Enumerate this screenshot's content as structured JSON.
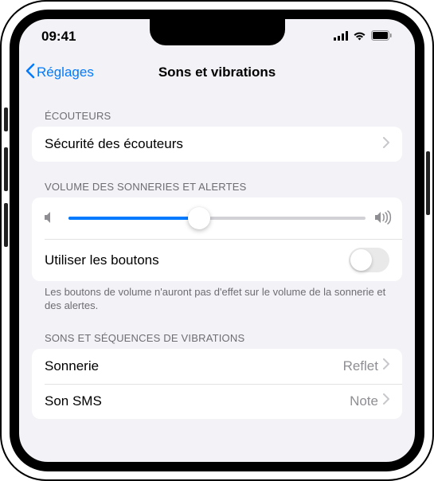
{
  "statusbar": {
    "time": "09:41"
  },
  "nav": {
    "back": "Réglages",
    "title": "Sons et vibrations"
  },
  "sections": {
    "headphones": {
      "header": "ÉCOUTEURS",
      "safety_label": "Sécurité des écouteurs"
    },
    "volume": {
      "header": "VOLUME DES SONNERIES ET ALERTES",
      "slider_value": 44,
      "buttons_label": "Utiliser les boutons",
      "buttons_footer": "Les boutons de volume n'auront pas d'effet sur le volume de la sonnerie et des alertes."
    },
    "sounds": {
      "header": "SONS ET SÉQUENCES DE VIBRATIONS",
      "items": [
        {
          "label": "Sonnerie",
          "value": "Reflet"
        },
        {
          "label": "Son SMS",
          "value": "Note"
        }
      ]
    }
  }
}
